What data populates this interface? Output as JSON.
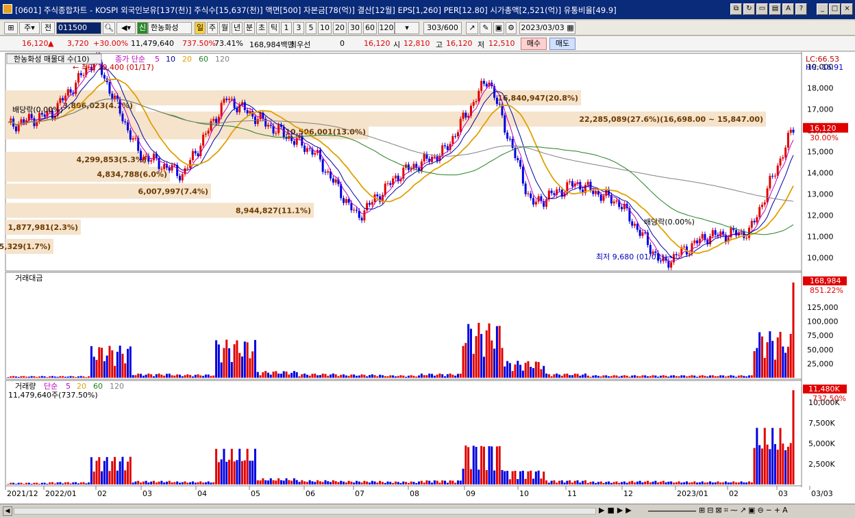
{
  "window": {
    "title": "[0601] 주식종합차트 - KOSPI 외국인보유[137(천)] 주식수[15,637(천)] 액면[500] 자본금[78(억)] 결산[12월] EPS[1,260] PER[12.80] 시가총액[2,521(억)] 유통비율[49.9]"
  },
  "toolbar": {
    "period_select": "주",
    "prev_label": "전",
    "code": "011500",
    "market_badge": "신",
    "stock_name": "한농화성",
    "period_buttons": [
      "일",
      "주",
      "월",
      "년",
      "분",
      "초",
      "틱"
    ],
    "minute_buttons": [
      "1",
      "3",
      "5",
      "10",
      "20",
      "30",
      "60",
      "120"
    ],
    "count": "303/600",
    "date": "2023/03/03"
  },
  "quote": {
    "price": "16,120",
    "change": "3,720",
    "change_pct": "+30.00%",
    "volume": "11,479,640",
    "volume_pct": "737.50%",
    "ratio": "73.41%",
    "trade_amount": "168,984백만",
    "best_bid_label": "최우선",
    "best_bid": "0",
    "ask": "16,120",
    "open_label": "시",
    "open": "12,810",
    "high_label": "고",
    "high": "16,120",
    "low_label": "저",
    "low": "12,510",
    "buy_label": "매수",
    "sell_label": "매도"
  },
  "price_panel": {
    "legend_title": "한농화성 매물대 수(10)",
    "ma_label": "종가 단순",
    "ma_periods": [
      "5",
      "10",
      "20",
      "60",
      "120"
    ],
    "max_label": "최고 19,400 (01/17)",
    "min_label": "최저 9,680 (01/03)",
    "dividend1": "배당락(0.00%)",
    "dividend2": "배당락(0.00%)",
    "lc": "LC:66.53",
    "hc": "HC:-16.91",
    "price_badge": "16,120",
    "price_badge_pct": "30.00%",
    "y_ticks": [
      "19,000",
      "18,000",
      "17,000",
      "16,000",
      "15,000",
      "14,000",
      "13,000",
      "12,000",
      "11,000",
      "10,000"
    ],
    "volume_profile": [
      {
        "label": "16,840,947(20.8%)"
      },
      {
        "label": "22,285,089(27.6%)(16,698.00 ~ 15,847.00)"
      },
      {
        "label": "3,806,023(4.7%)"
      },
      {
        "label": "10,506,001(13.0%)"
      },
      {
        "label": "4,299,853(5.3%)"
      },
      {
        "label": "4,834,788(6.0%)"
      },
      {
        "label": "6,007,997(7.4%)"
      },
      {
        "label": "8,944,827(11.1%)"
      },
      {
        "label": "1,877,981(2.3%)"
      },
      {
        "label": "1,405,329(1.7%)"
      }
    ]
  },
  "amount_panel": {
    "title": "거래대금",
    "badge": "168,984",
    "badge_pct": "851.22%",
    "y_ticks": [
      "125,000",
      "100,000",
      "75,000",
      "50,000",
      "25,000"
    ]
  },
  "volume_panel": {
    "title": "거래량",
    "ma_label": "단순",
    "ma_periods": [
      "5",
      "20",
      "60",
      "120"
    ],
    "value": "11,479,640주(737.50%)",
    "badge": "11,480K",
    "badge_pct": "737.50%",
    "y_ticks": [
      "10,000K",
      "7,500K",
      "5,000K",
      "2,500K"
    ]
  },
  "x_axis": [
    "2021/12",
    "2022/01",
    "02",
    "03",
    "04",
    "05",
    "06",
    "07",
    "08",
    "09",
    "10",
    "11",
    "12",
    "2023/01",
    "02",
    "03",
    "03/03"
  ],
  "colors": {
    "up": "#e00000",
    "down": "#0000e0",
    "profile": "#f5e3cc",
    "ma5": "#c000c0",
    "ma10": "#0000a0",
    "ma20": "#e0a000",
    "ma60": "#208020",
    "ma120": "#808080"
  },
  "chart_data": [
    {
      "type": "line",
      "title": "한농화성",
      "x": [
        "2021/12",
        "2022/01",
        "2022/01/17",
        "2022/02",
        "2022/03",
        "2022/04",
        "2022/05",
        "2022/06",
        "2022/07",
        "2022/08",
        "2022/09",
        "2022/09 mid",
        "2022/10",
        "2022/11",
        "2022/12",
        "2023/01/03",
        "2023/01",
        "2023/02",
        "2023/03/03"
      ],
      "series": [
        {
          "name": "종가",
          "values": [
            16200,
            16800,
            19400,
            14900,
            13900,
            17500,
            16200,
            15000,
            11900,
            14000,
            15000,
            18500,
            12500,
            13500,
            12600,
            9680,
            11000,
            11200,
            16120
          ]
        }
      ],
      "ylim": [
        9500,
        19500
      ]
    },
    {
      "type": "bar",
      "title": "거래대금",
      "values_note": "",
      "series": [
        {
          "name": "거래대금",
          "values": [
            2000,
            2000,
            38000,
            5000,
            4000,
            45000,
            8000,
            5000,
            4000,
            3000,
            5000,
            65000,
            20000,
            5000,
            3000,
            3000,
            3000,
            3000,
            55000,
            168984
          ]
        }
      ],
      "ylim": [
        0,
        170000
      ]
    },
    {
      "type": "bar",
      "title": "거래량",
      "series": [
        {
          "name": "거래량",
          "values": [
            150,
            200,
            2300,
            300,
            250,
            2900,
            500,
            350,
            300,
            250,
            350,
            3400,
            1200,
            350,
            250,
            300,
            250,
            250,
            4600,
            11480
          ]
        }
      ],
      "ylim": [
        0,
        11500
      ]
    }
  ]
}
